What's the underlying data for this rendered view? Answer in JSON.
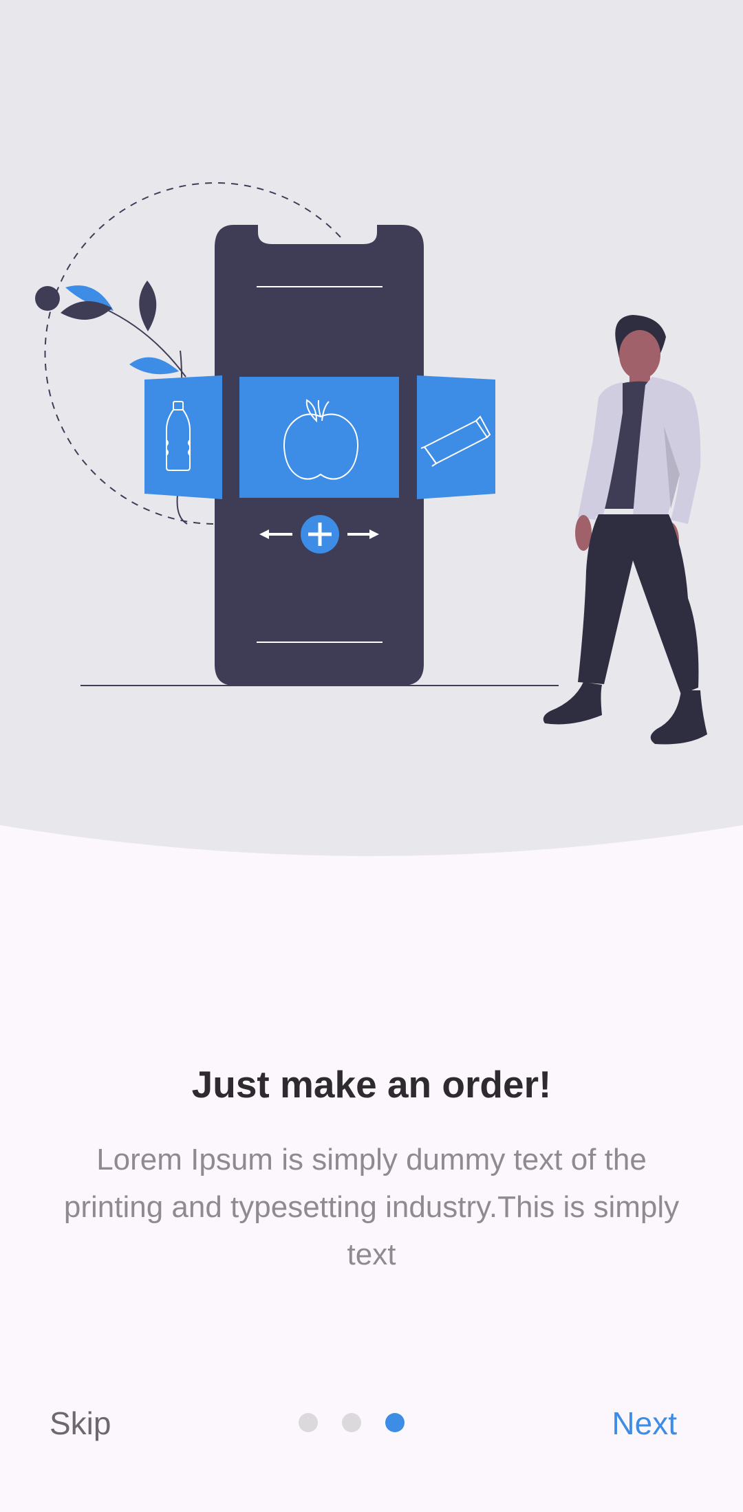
{
  "onboarding": {
    "title": "Just make an order!",
    "description": "Lorem Ipsum is simply dummy text of the printing and typesetting industry.This is simply text",
    "page_count": 3,
    "current_page": 3
  },
  "navigation": {
    "skip_label": "Skip",
    "next_label": "Next"
  },
  "colors": {
    "accent": "#3D8DE7",
    "hero_background": "#E8E7EC",
    "page_background": "#FCF7FD",
    "phone_body": "#3F3D56",
    "title_text": "#2D2B2E",
    "body_text": "#8E8A90"
  },
  "illustration": {
    "icons": [
      "bottle-icon",
      "apple-icon",
      "snack-bar-icon",
      "plus-icon",
      "arrow-left-icon",
      "arrow-right-icon"
    ]
  }
}
